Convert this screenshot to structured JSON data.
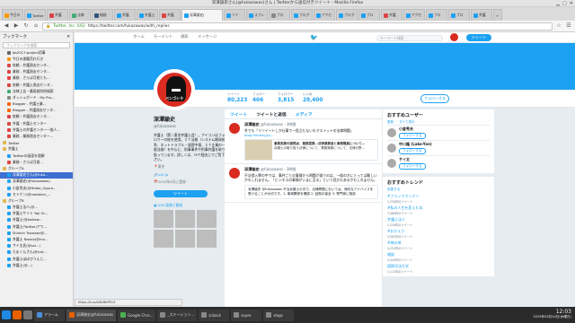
{
  "window": {
    "title": "深澤諭史さん(@fukazawas)さん | Twitterから送信付きツイート - Mozilla Firefox",
    "controls": [
      "▁",
      "▢",
      "✕"
    ]
  },
  "tabs": [
    {
      "label": "今日の",
      "color": "#ff9900"
    },
    {
      "label": "Twitter",
      "color": "#1da1f2"
    },
    {
      "label": "弁護",
      "color": "#d44"
    },
    {
      "label": "法律",
      "color": "#4a7"
    },
    {
      "label": "総務",
      "color": "#357"
    },
    {
      "label": "弁護",
      "color": "#1da1f2"
    },
    {
      "label": "弁護士",
      "color": "#1da1f2"
    },
    {
      "label": "弁護",
      "color": "#d44"
    },
    {
      "label": "深澤諭史(",
      "color": "#1da1f2",
      "active": true
    },
    {
      "label": "ツイ",
      "color": "#1da1f2"
    },
    {
      "label": "スプレ",
      "color": "#1da1f2"
    },
    {
      "label": "ブロ",
      "color": "#888"
    },
    {
      "label": "ブログ",
      "color": "#1da1f2"
    },
    {
      "label": "アクセ",
      "color": "#1da1f2"
    },
    {
      "label": "ブログ",
      "color": "#1da1f2"
    },
    {
      "label": "ブロ",
      "color": "#1da1f2"
    },
    {
      "label": "弁護",
      "color": "#d44"
    },
    {
      "label": "アクセ",
      "color": "#1da1f2"
    },
    {
      "label": "ブロ",
      "color": "#1da1f2"
    },
    {
      "label": "ブロ",
      "color": "#1da1f2"
    },
    {
      "label": "弁護",
      "color": "#1da1f2"
    }
  ],
  "nav": {
    "url_host": "Twitter, Inc. (US)",
    "url": "https://twitter.com/fukazawas/with_replies"
  },
  "sidebar": {
    "title": "ブックマーク",
    "search_placeholder": "ブックマークを検索",
    "items": [
      {
        "label": "bb2017:project用事",
        "color": "#666"
      },
      {
        "label": "今日の書籍売れ行き",
        "color": "#ff9900"
      },
      {
        "label": "依頼 - 弁護過去センタ...",
        "color": "#d44"
      },
      {
        "label": "業務 - 弁護過去センタ...",
        "color": "#d44"
      },
      {
        "label": "業務 - さらば月極とも...",
        "color": "#d44"
      },
      {
        "label": "依頼・弁護士過去センタ...",
        "color": "#d44"
      },
      {
        "label": "法律上告・最高裁判例検索",
        "color": "#4a7"
      },
      {
        "label": "ダッシュボード - My Pro...",
        "color": "#888"
      },
      {
        "label": "Blogger - 弁護士業...",
        "color": "#f60"
      },
      {
        "label": "Blogger - 弁護過去センタ...",
        "color": "#f60"
      },
      {
        "label": "依頼・弁護過去センタ...",
        "color": "#d44"
      },
      {
        "label": "弁護・弁護士センター",
        "color": "#d44"
      },
      {
        "label": "弁護士の弁護センター一般人...",
        "color": "#d44"
      },
      {
        "label": "業務 - 業務過去センター...",
        "color": "#d44"
      },
      {
        "label": "Twitter",
        "color": "#1da1f2",
        "folder": true
      },
      {
        "label": "弁護士",
        "color": "#888",
        "folder": true
      },
      {
        "label": "Twitterの画面を理解",
        "color": "#1da1f2"
      },
      {
        "label": "業務・さらば月極...",
        "color": "#d44"
      },
      {
        "label": "グループA",
        "color": "#888",
        "folder": true
      },
      {
        "label": "深澤諭史さん(@fuka...",
        "color": "#1da1f2",
        "selected": true
      },
      {
        "label": "深澤諭史(@fukazawas)",
        "color": "#1da1f2"
      },
      {
        "label": "小倉秀夫(@Hideo_Ogura...",
        "color": "#1da1f2"
      },
      {
        "label": "モトケン(@motoken_...",
        "color": "#1da1f2"
      },
      {
        "label": "グループB",
        "color": "#888",
        "folder": true
      },
      {
        "label": "弁護士法人(@...",
        "color": "#1da1f2"
      },
      {
        "label": "弁護士サイト Yoji Or...",
        "color": "#1da1f2"
      },
      {
        "label": "弁護士(@koikaw...",
        "color": "#1da1f2"
      },
      {
        "label": "弁護士(Twitter/アワ...",
        "color": "#1da1f2"
      },
      {
        "label": "Shinkin Tsuwaw(@...",
        "color": "#1da1f2"
      },
      {
        "label": "弁護士 Nanoo(@mu...",
        "color": "#1da1f2"
      },
      {
        "label": "サイ太氏(@sai...)",
        "color": "#1da1f2"
      },
      {
        "label": "たまくんさん(@nat...",
        "color": "#1da1f2"
      },
      {
        "label": "弁護士ほぼびうんじ...",
        "color": "#1da1f2"
      },
      {
        "label": "弁護士(@...)",
        "color": "#1da1f2"
      }
    ]
  },
  "twitter_nav": {
    "home": "ホーム",
    "moments": "モーメント",
    "notifications": "通知",
    "messages": "メッセージ",
    "search_placeholder": "キーワード検索",
    "tweet_button": "ツイート"
  },
  "profile_stats": [
    {
      "label": "ツイート",
      "value": "80,223"
    },
    {
      "label": "フォロー",
      "value": "406"
    },
    {
      "label": "フォロワー",
      "value": "3,815"
    },
    {
      "label": "いいね",
      "value": "29,400"
    }
  ],
  "follow_button": "フォローする",
  "avatar_text": "ベンゴシラ",
  "profile": {
    "name": "深澤諭史",
    "handle": "@fukazawas",
    "bio": "弁護士（第二東京弁護士会）。アイコンはフォロワーの絵を使用。ＩＴ法務（システム開発紛争、ネットトラブル・誹謗中傷、ＩＴ企業の一般法務）を中心に、刑事事件や刑事弁護を取り扱っています。詳しくは、ＨＰ経由上でご覧下さい。",
    "location": "東京",
    "link": "s-fk.jp",
    "joined": "2010年6月に登録",
    "tweet_to": "ツイート",
    "media_label": "256 画像と動画"
  },
  "timeline": {
    "tabs": [
      "ツイート",
      "ツイートと返信",
      "メディア"
    ],
    "tweets": [
      {
        "name": "深澤諭史",
        "handle": "@fukazawas",
        "time": "3時間",
        "text": "冬でも「リツイートしか仕事で一役立たないもマスメットの法律問題」",
        "link": "blog.frenkay.jp/...",
        "card_title": "事務実務の疑問点、業務提携…法律業務者と事務職員について…",
        "card_text": "弁護士の取り扱う法律について、業務実務について、法律分野…"
      },
      {
        "name": "深澤諭史",
        "handle": "@fukazawas",
        "time": "3時間",
        "text": "不法侵入罪の中では、事件ごとの事情から問題が違うのは、一般の方にとっては難しいかもしれません。「ビジネスの事情がいまに至る」という見方もあるかもしれません。",
        "quote": "深澤諭史 @fukazawas\n不当弁護士の中で、法律問題においては、適切なアドバイスを受けることが大切です。1. 事実関係を確認 2. 証拠の保全 3. 専門家に相談"
      }
    ]
  },
  "right": {
    "wtf_title": "おすすめユーザー",
    "wtf_sub": "更新 ・ すべて表示",
    "wtf": [
      {
        "name": "小倉秀夫",
        "button": "フォローする"
      },
      {
        "name": "中川隆 (Lake-Yon)",
        "button": "フォローする"
      },
      {
        "name": "サイ太",
        "button": "フォローする"
      }
    ],
    "trends_title": "おすすめトレンド",
    "trends_sub": "変更する",
    "trends": [
      {
        "name": "#ブラックマンデン",
        "count": "1,234件のツイート"
      },
      {
        "name": "#私の人生を変えた本",
        "count": "7,089件のツイート"
      },
      {
        "name": "弁護士法人",
        "count": "1,234件のツイート"
      },
      {
        "name": "#おかえり",
        "count": "3,567件のツイート"
      },
      {
        "name": "#神の神",
        "count": "4,231件のツイート"
      },
      {
        "name": "雑談",
        "count": "2,020件のツイート"
      },
      {
        "name": "国際司法大学",
        "count": "1,111件のツイート"
      }
    ]
  },
  "statusbar": {
    "text": "https://t.co/UKLBkPE15"
  },
  "taskbar": {
    "items": [
      {
        "label": "アラーム",
        "color": "#4a90d9"
      },
      {
        "label": "深澤諭史@fukazawas",
        "color": "#e66000",
        "active": true
      },
      {
        "label": "Google Chro...",
        "color": "#4caf50"
      },
      {
        "label": "_ステーション...",
        "color": "#888"
      },
      {
        "label": "scback",
        "color": "#888"
      },
      {
        "label": "sayes",
        "color": "#888"
      },
      {
        "label": "xlogs",
        "color": "#888"
      }
    ],
    "time": "12:03",
    "date": "2019年03月14日(木曜日)"
  },
  "colors": {
    "twitter_blue": "#1da1f2",
    "avatar_red": "#d92b1f"
  }
}
